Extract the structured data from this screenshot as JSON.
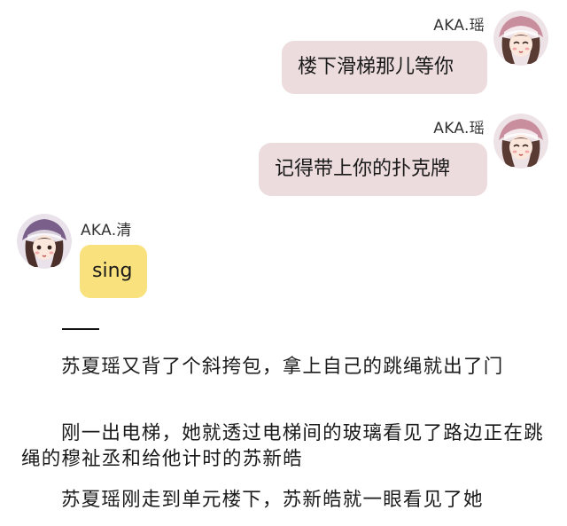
{
  "messages": [
    {
      "sender": "AKA.瑶",
      "text": "楼下滑梯那儿等你",
      "side": "right",
      "color": "#ecdcdd"
    },
    {
      "sender": "AKA.瑶",
      "text": "记得带上你的扑克牌",
      "side": "right",
      "color": "#ecdcdd"
    },
    {
      "sender": "AKA.清",
      "text": "sing",
      "side": "left",
      "color": "#f9e27e"
    }
  ],
  "separator": "——",
  "paragraphs": [
    "苏夏瑶又背了个斜挎包，拿上自己的跳绳就出了门",
    "刚一出电梯，她就透过电梯间的玻璃看见了路边正在跳绳的穆祉丞和给他计时的苏新皓",
    "苏夏瑶刚走到单元楼下，苏新皓就一眼看见了她"
  ],
  "icons": {
    "avatar_yao": "avatar-girl-icon",
    "avatar_qing": "avatar-girl-icon"
  }
}
